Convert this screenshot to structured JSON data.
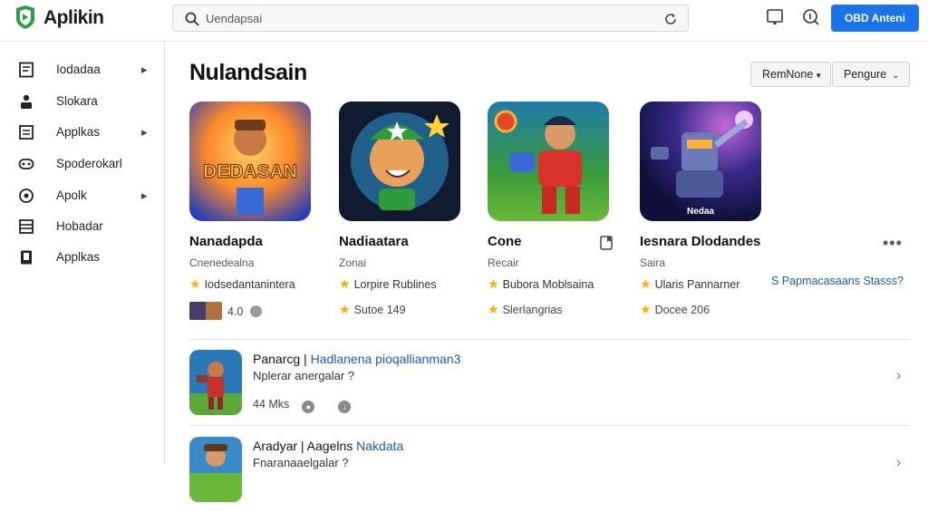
{
  "app": {
    "name": "Aplikin"
  },
  "search": {
    "text": "Uendapsai"
  },
  "header": {
    "primary_button": "OBD Anteni"
  },
  "sidebar": {
    "items": [
      {
        "label": "Iodadaa",
        "icon": "document-icon",
        "chevron": true
      },
      {
        "label": "Slokara",
        "icon": "person-icon",
        "chevron": false
      },
      {
        "label": "Applkas",
        "icon": "list-icon",
        "chevron": true
      },
      {
        "label": "Spoderokarl",
        "icon": "controller-icon",
        "chevron": false
      },
      {
        "label": "Apolk",
        "icon": "circle-icon",
        "chevron": true
      },
      {
        "label": "Hobadar",
        "icon": "menu-icon",
        "chevron": false
      },
      {
        "label": "Applkas",
        "icon": "device-icon",
        "chevron": false
      }
    ]
  },
  "main": {
    "title": "Nulandsain",
    "dropdowns": [
      "RemNone",
      "Pengure"
    ],
    "cards": [
      {
        "title": "Nanadapda",
        "subtitle": "Cnenedealna",
        "rating_text": "Iodsedantanintera",
        "meta": "4.0",
        "thumb_text": "DEDASAN"
      },
      {
        "title": "Nadiaatara",
        "subtitle": "Zonai",
        "rating_text": "Lorpire Rublines",
        "meta": "Sutoe 149"
      },
      {
        "title": "Cone",
        "subtitle": "Recair",
        "rating_text": "Bubora Moblsaina",
        "meta": "Slerlangrias"
      },
      {
        "title": "Iesnara Dlodandes",
        "subtitle": "Saira",
        "rating_text": "Ularis Pannarner",
        "meta": "Docee 206",
        "thumb_text": "Nedaa"
      }
    ],
    "related_link": "S Papmacasaans Stasss?",
    "list": [
      {
        "title_main": "Panarcg | ",
        "title_highlight": "Hadlanena pioqallianman3",
        "subtitle": "Nplerar anergalar ?",
        "meta": "44 Mks"
      },
      {
        "title_main": "Aradyar | Aagelns ",
        "title_highlight": "Nakdata",
        "subtitle": "Fnaranaaelgalar ?",
        "meta": ""
      }
    ]
  },
  "colors": {
    "accent": "#1a73e8",
    "link": "#1a56c8",
    "star": "#f5b400"
  }
}
